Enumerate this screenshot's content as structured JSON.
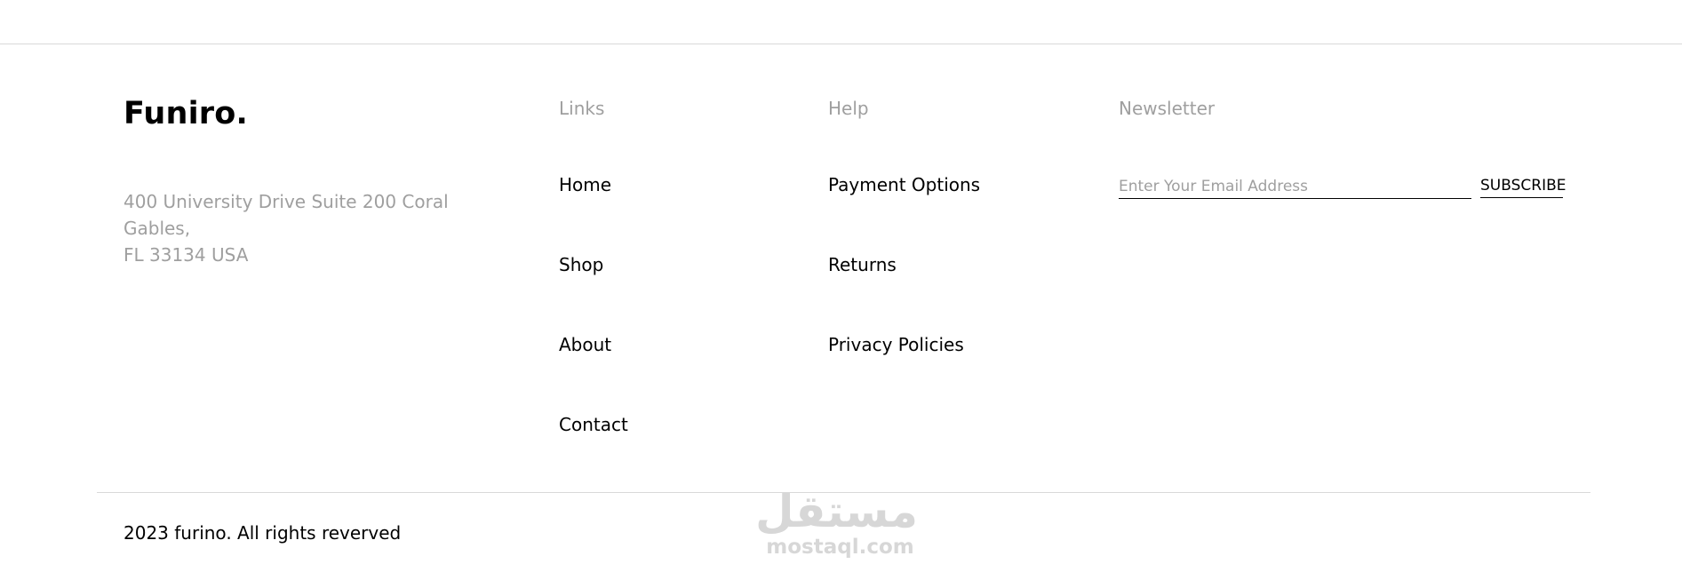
{
  "brand": {
    "name": "Funiro."
  },
  "address": {
    "line1": "400 University Drive Suite 200 Coral",
    "line2": "Gables,",
    "line3": "FL 33134 USA"
  },
  "links": {
    "heading": "Links",
    "items": [
      "Home",
      "Shop",
      "About",
      "Contact"
    ]
  },
  "help": {
    "heading": "Help",
    "items": [
      "Payment Options",
      "Returns",
      "Privacy Policies"
    ]
  },
  "newsletter": {
    "heading": "Newsletter",
    "email_placeholder": "Enter Your Email Address",
    "email_value": "",
    "subscribe_label": "SUBSCRIBE"
  },
  "footer": {
    "copyright": "2023 furino. All rights reverved"
  },
  "watermark": {
    "logo_text": "مستقل",
    "url": "mostaql.com"
  },
  "colors": {
    "muted_text": "#9f9f9f",
    "primary_text": "#000000",
    "divider": "#d9d9d9",
    "watermark": "#d7d7d7"
  }
}
